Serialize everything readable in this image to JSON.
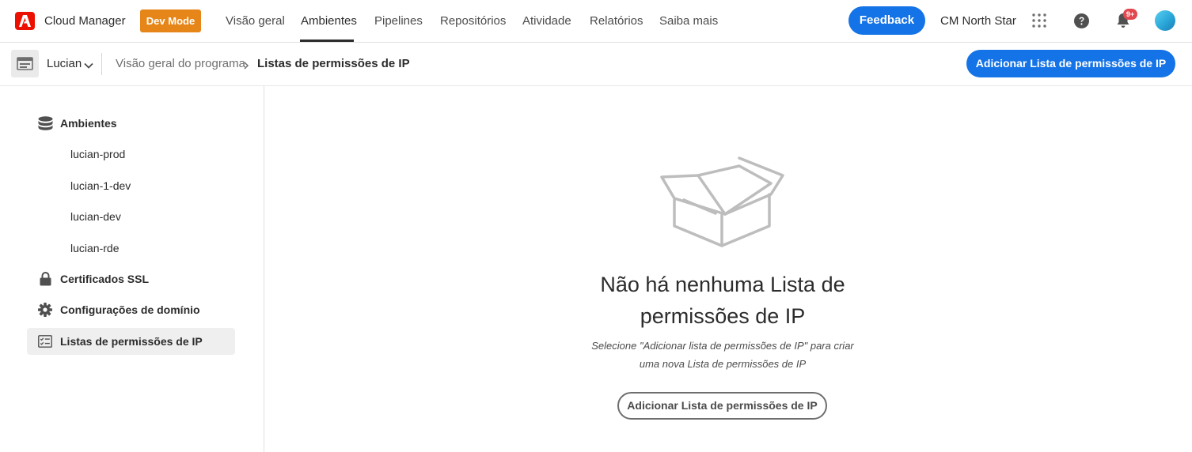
{
  "header": {
    "app_name": "Cloud Manager",
    "dev_mode_label": "Dev Mode",
    "nav": [
      "Visão geral",
      "Ambientes",
      "Pipelines",
      "Repositórios",
      "Atividade",
      "Relatórios",
      "Saiba mais"
    ],
    "active_nav": "Ambientes",
    "feedback_label": "Feedback",
    "org_name": "CM North Star",
    "notification_badge": "9+",
    "icons": [
      "adobe-logo-icon",
      "apps-grid-icon",
      "help-icon",
      "bell-icon",
      "user-avatar"
    ],
    "accent_color": "#1473e6",
    "dev_mode_color": "#e68619"
  },
  "subbar": {
    "program_name": "Lucian",
    "breadcrumb": [
      "Visão geral do programa",
      "Listas de permissões de IP"
    ],
    "add_button_label": "Adicionar Lista de permissões de IP"
  },
  "sidebar": {
    "environments_label": "Ambientes",
    "environments": [
      "lucian-prod",
      "lucian-1-dev",
      "lucian-dev",
      "lucian-rde"
    ],
    "ssl_label": "Certificados SSL",
    "domain_label": "Configurações de domínio",
    "ip_lists_label": "Listas de permissões de IP",
    "selected_item": "Listas de permissões de IP"
  },
  "empty_state": {
    "title_line1": "Não há nenhuma Lista de",
    "title_line2": "permissões de IP",
    "desc_line1": "Selecione \"Adicionar lista de permissões de IP\" para criar",
    "desc_line2": "uma nova Lista de permissões de IP",
    "button_label": "Adicionar Lista de permissões de IP"
  }
}
